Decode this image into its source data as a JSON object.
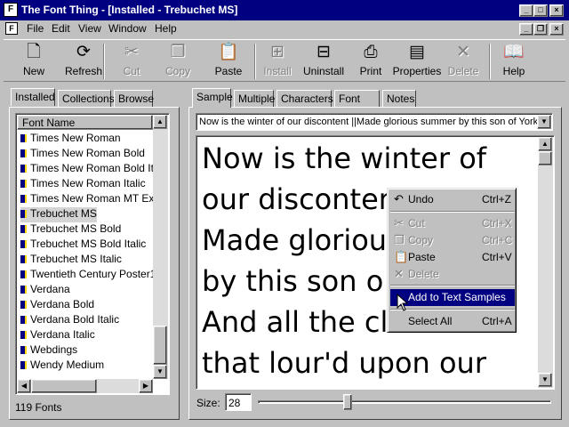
{
  "window": {
    "title": "The Font Thing - [Installed - Trebuchet MS]"
  },
  "menu": [
    "File",
    "Edit",
    "View",
    "Window",
    "Help"
  ],
  "toolbar": {
    "buttons": [
      {
        "label": "New",
        "icon": "new-doc-icon",
        "glyph": "🗋",
        "enabled": true
      },
      {
        "label": "Refresh",
        "icon": "refresh-icon",
        "glyph": "⟳",
        "enabled": true
      },
      {
        "label": "Cut",
        "icon": "scissors-icon",
        "glyph": "✂",
        "enabled": false
      },
      {
        "label": "Copy",
        "icon": "copy-icon",
        "glyph": "❐",
        "enabled": false
      },
      {
        "label": "Paste",
        "icon": "paste-icon",
        "glyph": "📋",
        "enabled": true
      },
      {
        "label": "Install",
        "icon": "install-icon",
        "glyph": "⊞",
        "enabled": false
      },
      {
        "label": "Uninstall",
        "icon": "uninstall-icon",
        "glyph": "⊟",
        "enabled": true
      },
      {
        "label": "Print",
        "icon": "printer-icon",
        "glyph": "⎙",
        "enabled": true
      },
      {
        "label": "Properties",
        "icon": "properties-icon",
        "glyph": "▤",
        "enabled": true
      },
      {
        "label": "Delete",
        "icon": "delete-icon",
        "glyph": "✕",
        "enabled": false
      },
      {
        "label": "Help",
        "icon": "help-book-icon",
        "glyph": "📖",
        "enabled": true
      }
    ]
  },
  "left_tabs": [
    "Installed",
    "Collections",
    "Browse"
  ],
  "font_list": {
    "header": "Font Name",
    "items": [
      "Times New Roman",
      "Times New Roman Bold",
      "Times New Roman Bold It...",
      "Times New Roman Italic",
      "Times New Roman MT Ex...",
      "Trebuchet MS",
      "Trebuchet MS Bold",
      "Trebuchet MS Bold Italic",
      "Trebuchet MS Italic",
      "Twentieth Century Poster1",
      "Verdana",
      "Verdana Bold",
      "Verdana Bold Italic",
      "Verdana Italic",
      "Webdings",
      "Wendy Medium"
    ],
    "selected_index": 5,
    "count": "119 Fonts"
  },
  "right_tabs": [
    "Sample",
    "Multiple",
    "Characters",
    "Font Info",
    "Notes"
  ],
  "sample": {
    "combo_text": "Now is the winter of our discontent ||Made glorious summer by this son of York; ||",
    "lines": [
      "Now is the winter of",
      "our disconten",
      "Made glorious",
      "by this son o",
      "And all the clouds",
      "that lour'd upon our"
    ],
    "size_label": "Size:",
    "size_value": "28",
    "slider_level": 0.3
  },
  "context_menu": {
    "items": [
      {
        "label": "Undo",
        "shortcut": "Ctrl+Z",
        "icon": "undo-icon",
        "glyph": "↶",
        "enabled": true
      },
      {
        "label": "Cut",
        "shortcut": "Ctrl+X",
        "icon": "scissors-icon",
        "glyph": "✂",
        "enabled": false
      },
      {
        "label": "Copy",
        "shortcut": "Ctrl+C",
        "icon": "copy-icon",
        "glyph": "❐",
        "enabled": false
      },
      {
        "label": "Paste",
        "shortcut": "Ctrl+V",
        "icon": "paste-icon",
        "glyph": "📋",
        "enabled": true
      },
      {
        "label": "Delete",
        "shortcut": "",
        "icon": "delete-icon",
        "glyph": "✕",
        "enabled": false
      },
      {
        "label": "Add to Text Samples",
        "shortcut": "",
        "icon": "",
        "glyph": "",
        "enabled": true
      },
      {
        "label": "Select All",
        "shortcut": "Ctrl+A",
        "icon": "",
        "glyph": "",
        "enabled": true
      }
    ]
  },
  "colors": {
    "titlebar": "#000080",
    "face": "#c0c0c0",
    "highlight": "#000080"
  }
}
